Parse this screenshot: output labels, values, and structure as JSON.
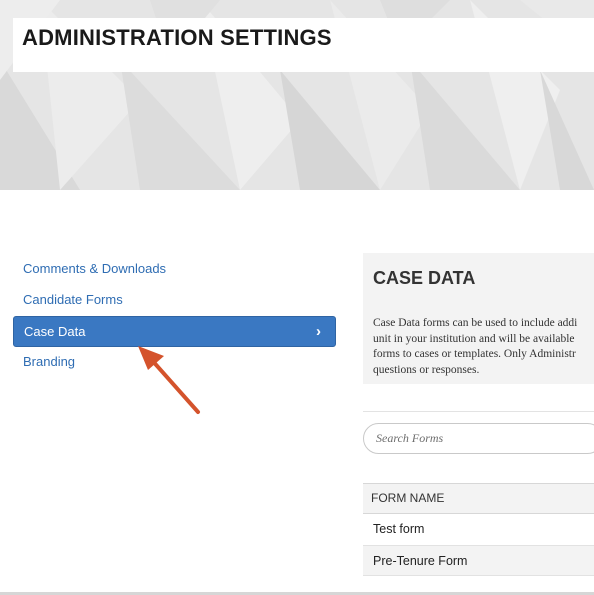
{
  "header": {
    "title": "ADMINISTRATION SETTINGS"
  },
  "sidebar": {
    "items": [
      {
        "label": "Comments & Downloads",
        "active": false
      },
      {
        "label": "Candidate Forms",
        "active": false
      },
      {
        "label": "Case Data",
        "active": true
      },
      {
        "label": "Branding",
        "active": false
      }
    ]
  },
  "panel": {
    "title": "CASE DATA",
    "description_lines": [
      "Case Data forms can be used to include addi",
      "unit in your institution and will be available",
      "forms to cases or templates. Only Administr",
      "questions or responses."
    ]
  },
  "search": {
    "placeholder": "Search Forms"
  },
  "table": {
    "column_header": "FORM NAME",
    "rows": [
      "Test form",
      "Pre-Tenure Form"
    ]
  },
  "colors": {
    "accent": "#3a78c2",
    "link": "#2f6db3",
    "annotation_arrow": "#d4532c"
  },
  "icons": {
    "active_item_chevron": "chevron-right-icon"
  }
}
